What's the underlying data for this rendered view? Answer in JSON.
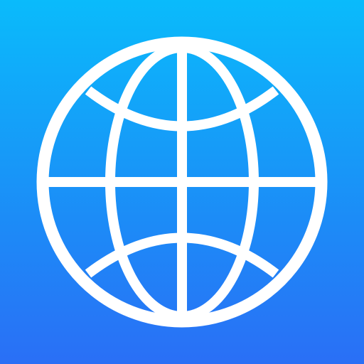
{
  "app_icon": {
    "icon": "globe-icon",
    "background_colors": [
      "#0abbfb",
      "#1c8cf7",
      "#2a6ff6"
    ],
    "foreground_color": "#ffffff"
  }
}
